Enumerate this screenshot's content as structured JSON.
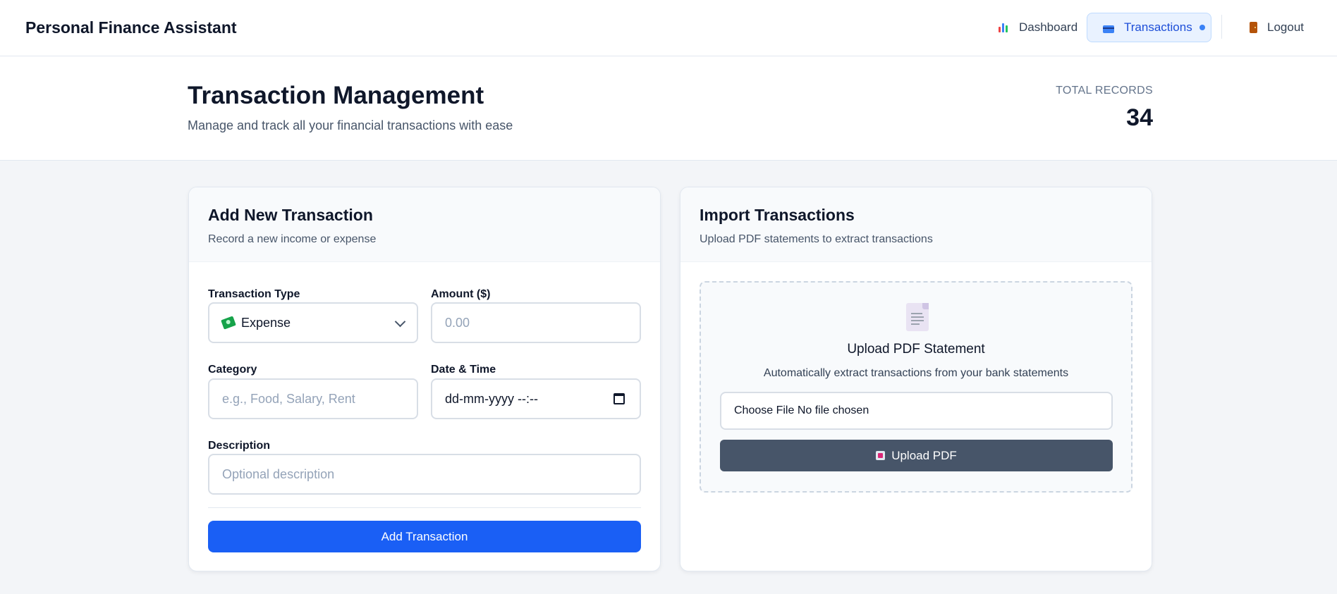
{
  "app": {
    "title": "Personal Finance Assistant"
  },
  "nav": {
    "items": [
      {
        "label": "Dashboard",
        "icon": "bar-chart-icon"
      },
      {
        "label": "Transactions",
        "icon": "credit-card-icon",
        "active": true
      },
      {
        "label": "Logout",
        "icon": "door-icon"
      }
    ]
  },
  "header": {
    "title": "Transaction Management",
    "subtitle": "Manage and track all your financial transactions with ease",
    "records_label": "TOTAL RECORDS",
    "records_value": "34"
  },
  "add_form": {
    "title": "Add New Transaction",
    "subtitle": "Record a new income or expense",
    "type_label": "Transaction Type",
    "type_value": "Expense",
    "amount_label": "Amount ($)",
    "amount_placeholder": "0.00",
    "category_label": "Category",
    "category_placeholder": "e.g., Food, Salary, Rent",
    "datetime_label": "Date & Time",
    "datetime_value": "dd-mm-yyyy --:--",
    "description_label": "Description",
    "description_placeholder": "Optional description",
    "submit_label": "Add Transaction"
  },
  "import": {
    "title": "Import Transactions",
    "subtitle": "Upload PDF statements to extract transactions",
    "dropzone_title": "Upload PDF Statement",
    "dropzone_sub": "Automatically extract transactions from your bank statements",
    "file_input_text": "Choose File No file chosen",
    "upload_label": "Upload PDF"
  },
  "colors": {
    "primary": "#1a5ff5",
    "secondary_button": "#475569",
    "active_nav_bg": "#e9f2ff",
    "active_nav_text": "#1d4ed8"
  }
}
